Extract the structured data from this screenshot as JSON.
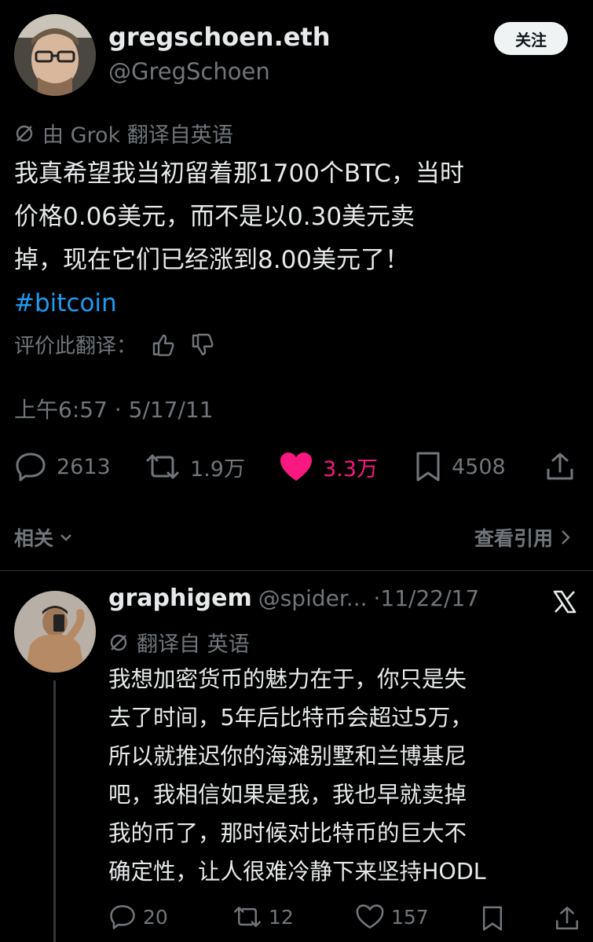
{
  "main_tweet": {
    "display_name": "gregschoen.eth",
    "handle": "@GregSchoen",
    "follow_label": "关注",
    "translation_note": "由 Grok 翻译自英语",
    "text_lines": [
      "我真希望我当初留着那1700个BTC，当时",
      "价格0.06美元，而不是以0.30美元卖",
      "掉，现在它们已经涨到8.00美元了！"
    ],
    "hashtag": "#bitcoin",
    "rate_translation": "评价此翻译：",
    "timestamp": "上午6:57 · 5/17/11",
    "stats": {
      "replies": "2613",
      "retweets": "1.9万",
      "likes": "3.3万",
      "bookmarks": "4508"
    },
    "like_color": "#f91880"
  },
  "related": {
    "label": "相关",
    "quotes_label": "查看引用"
  },
  "reply": {
    "display_name": "graphigem",
    "handle": "@spider...",
    "date": "·11/22/17",
    "translation_note": "翻译自 英语",
    "text_lines": [
      "我想加密货币的魅力在于，你只是失",
      "去了时间，5年后比特币会超过5万，",
      "所以就推迟你的海滩别墅和兰博基尼",
      "吧，我相信如果是我，我也早就卖掉",
      "我的币了，那时候对比特币的巨大不",
      "确定性，让人很难冷静下来坚持HODL"
    ],
    "stats": {
      "replies": "20",
      "retweets": "12",
      "likes": "157"
    }
  }
}
